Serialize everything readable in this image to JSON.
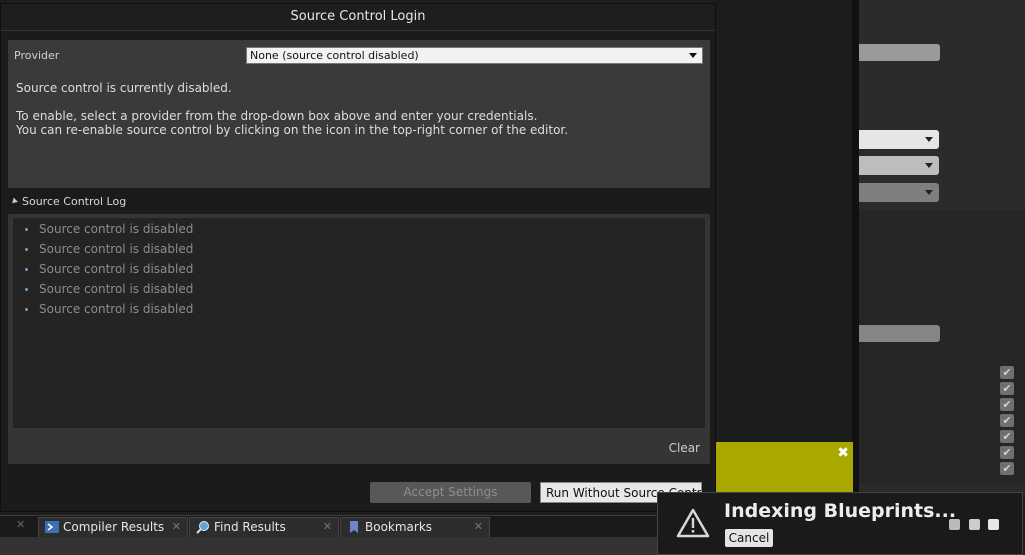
{
  "dialog": {
    "title": "Source Control Login",
    "provider_label": "Provider",
    "provider_value": "None  (source control disabled)",
    "status_message": "Source control is currently disabled.",
    "help_line1": "To enable, select a provider from the drop-down box above and enter your credentials.",
    "help_line2": "You can re-enable source control by clicking on the icon in the top-right corner of the editor.",
    "log_header": "Source Control Log",
    "log_entries": [
      "Source control is disabled",
      "Source control is disabled",
      "Source control is disabled",
      "Source control is disabled",
      "Source control is disabled"
    ],
    "clear_label": "Clear",
    "accept_label": "Accept Settings",
    "run_without_label": "Run Without Source Control"
  },
  "tabs": [
    {
      "label": "Compiler Results",
      "icon": "compiler-icon"
    },
    {
      "label": "Find Results",
      "icon": "magnifier-icon"
    },
    {
      "label": "Bookmarks",
      "icon": "bookmark-icon"
    }
  ],
  "notification": {
    "title": "Indexing Blueprints...",
    "cancel_label": "Cancel",
    "icon": "warning-icon"
  },
  "colors": {
    "accent_yellow": "#a8a800",
    "log_bullet": "#6a9fcf"
  }
}
